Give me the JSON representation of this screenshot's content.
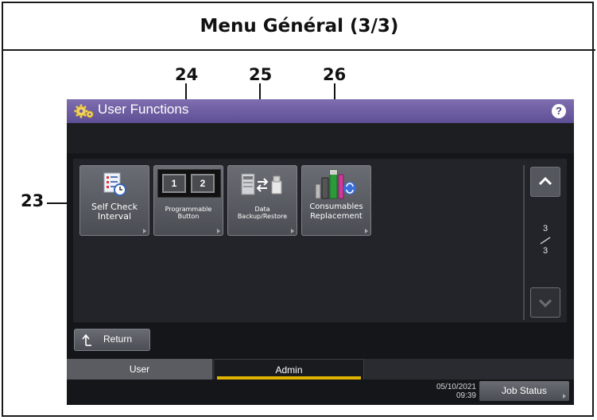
{
  "document": {
    "title": "Menu Général (3/3)"
  },
  "callouts": {
    "c23": "23",
    "c24": "24",
    "c25": "25",
    "c26": "26"
  },
  "app": {
    "title": "User Functions",
    "help": "?"
  },
  "functions": [
    {
      "id": "self-check-interval",
      "line1": "Self Check",
      "line2": "Interval"
    },
    {
      "id": "programmable-button",
      "line1": "Programmable",
      "line2": "Button",
      "digits": [
        "1",
        "2"
      ]
    },
    {
      "id": "data-backup-restore",
      "line1": "Data",
      "line2": "Backup/Restore"
    },
    {
      "id": "consumables-replacement",
      "line1": "Consumables",
      "line2": "Replacement"
    }
  ],
  "pager": {
    "current": "3",
    "total": "3"
  },
  "return_label": "Return",
  "tabs": {
    "user": "User",
    "admin": "Admin",
    "active": "Admin"
  },
  "status": {
    "date": "05/10/2021",
    "time": "09:39"
  },
  "job_status_label": "Job Status",
  "colors": {
    "titlebar": "#6f5fa3",
    "active_tab_underline": "#e0b400",
    "screen_bg": "#15161a"
  },
  "icons": [
    "gear-icon",
    "help-icon",
    "checklist-clock-icon",
    "digit-keys-icon",
    "copier-usb-transfer-icon",
    "toner-cartridge-icon",
    "chevron-up-icon",
    "chevron-down-icon",
    "return-arrow-icon"
  ]
}
